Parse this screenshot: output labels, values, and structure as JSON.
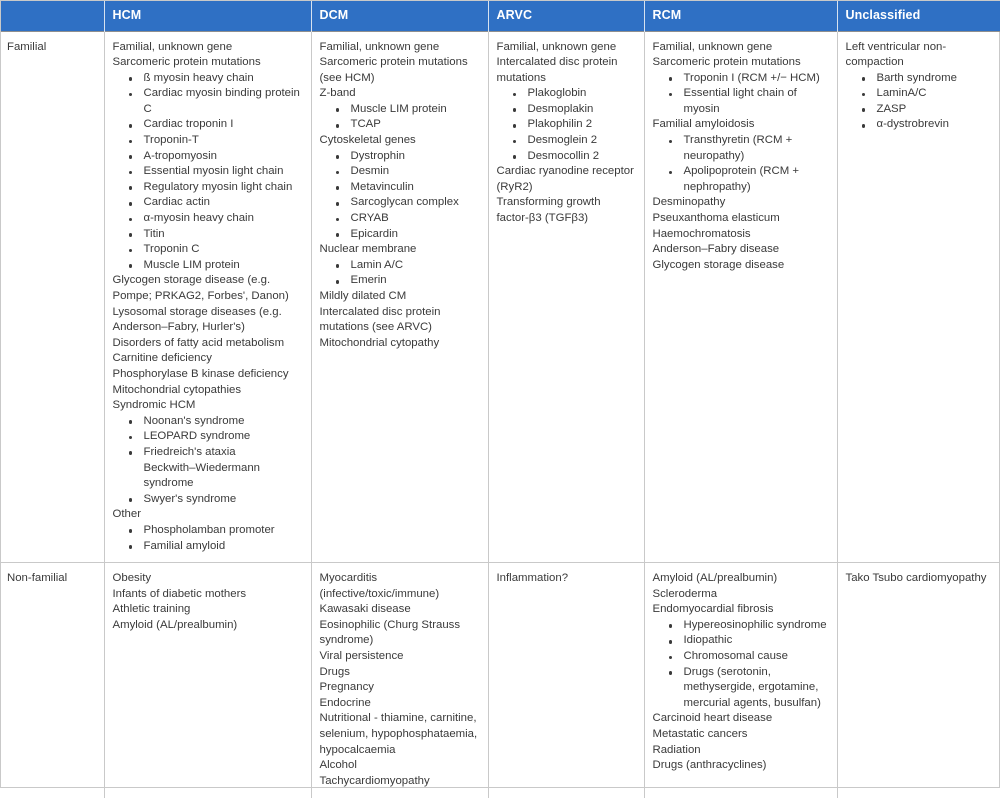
{
  "table": {
    "headers": [
      {
        "label": "",
        "name": "header-corner"
      },
      {
        "label": "HCM",
        "name": "header-hcm"
      },
      {
        "label": "DCM",
        "name": "header-dcm"
      },
      {
        "label": "ARVC",
        "name": "header-arvc"
      },
      {
        "label": "RCM",
        "name": "header-rcm"
      },
      {
        "label": "Unclassified",
        "name": "header-unclassified"
      }
    ],
    "header_bg": "#2f70c4",
    "header_text_color": "#ffffff",
    "body_text_color": "#3a3a3a",
    "border_color": "#c9c9c9",
    "rows": [
      {
        "label": "Familial",
        "cells": {
          "hcm": [
            {
              "text": "Familial, unknown gene",
              "style": "plain"
            },
            {
              "text": "Sarcomeric protein mutations",
              "style": "plain"
            },
            {
              "text": "ß myosin heavy chain",
              "style": "bulleted"
            },
            {
              "text": "Cardiac myosin binding protein C",
              "style": "bulleted"
            },
            {
              "text": "Cardiac troponin I",
              "style": "bulleted"
            },
            {
              "text": "Troponin-T",
              "style": "bulleted"
            },
            {
              "text": "A-tropomyosin",
              "style": "bulleted"
            },
            {
              "text": "Essential myosin light chain",
              "style": "bulleted"
            },
            {
              "text": "Regulatory myosin light chain",
              "style": "bulleted"
            },
            {
              "text": "Cardiac actin",
              "style": "bulleted"
            },
            {
              "text": "α-myosin heavy chain",
              "style": "bulleted"
            },
            {
              "text": "Titin",
              "style": "bulleted"
            },
            {
              "text": "Troponin C",
              "style": "bulleted"
            },
            {
              "text": "Muscle LIM protein",
              "style": "bulleted"
            },
            {
              "text": "Glycogen storage disease (e.g. Pompe; PRKAG2, Forbes', Danon)",
              "style": "plain"
            },
            {
              "text": "Lysosomal storage diseases (e.g. Anderson–Fabry, Hurler's)",
              "style": "plain"
            },
            {
              "text": "Disorders of fatty acid metabolism",
              "style": "plain"
            },
            {
              "text": "Carnitine deficiency",
              "style": "plain"
            },
            {
              "text": "Phosphorylase B kinase deficiency",
              "style": "plain"
            },
            {
              "text": "Mitochondrial cytopathies",
              "style": "plain"
            },
            {
              "text": "Syndromic HCM",
              "style": "plain"
            },
            {
              "text": "Noonan's syndrome",
              "style": "bulleted"
            },
            {
              "text": "LEOPARD syndrome",
              "style": "bulleted"
            },
            {
              "text": "Friedreich's ataxia",
              "style": "bulleted"
            },
            {
              "text": "Beckwith–Wiedermann syndrome",
              "style": "nobullet-indent"
            },
            {
              "text": "Swyer's syndrome",
              "style": "bulleted"
            },
            {
              "text": "Other",
              "style": "plain"
            },
            {
              "text": "Phospholamban promoter",
              "style": "bulleted"
            },
            {
              "text": "Familial amyloid",
              "style": "bulleted"
            }
          ],
          "dcm": [
            {
              "text": "Familial, unknown gene",
              "style": "plain"
            },
            {
              "text": "Sarcomeric protein mutations (see HCM)",
              "style": "plain"
            },
            {
              "text": "Z-band",
              "style": "plain"
            },
            {
              "text": "Muscle LIM protein",
              "style": "bulleted"
            },
            {
              "text": "TCAP",
              "style": "bulleted"
            },
            {
              "text": "Cytoskeletal genes",
              "style": "plain"
            },
            {
              "text": "Dystrophin",
              "style": "bulleted"
            },
            {
              "text": "Desmin",
              "style": "bulleted"
            },
            {
              "text": "Metavinculin",
              "style": "bulleted"
            },
            {
              "text": "Sarcoglycan complex",
              "style": "bulleted"
            },
            {
              "text": "CRYAB",
              "style": "bulleted"
            },
            {
              "text": "Epicardin",
              "style": "bulleted"
            },
            {
              "text": "Nuclear membrane",
              "style": "plain"
            },
            {
              "text": "Lamin A/C",
              "style": "bulleted"
            },
            {
              "text": "Emerin",
              "style": "bulleted"
            },
            {
              "text": "Mildly dilated CM",
              "style": "plain"
            },
            {
              "text": "Intercalated disc protein mutations (see ARVC)",
              "style": "plain"
            },
            {
              "text": "Mitochondrial cytopathy",
              "style": "plain"
            }
          ],
          "arvc": [
            {
              "text": "Familial, unknown gene",
              "style": "plain"
            },
            {
              "text": "Intercalated disc protein mutations",
              "style": "plain"
            },
            {
              "text": "Plakoglobin",
              "style": "bulleted"
            },
            {
              "text": "Desmoplakin",
              "style": "bulleted"
            },
            {
              "text": "Plakophilin 2",
              "style": "bulleted"
            },
            {
              "text": "Desmoglein 2",
              "style": "bulleted"
            },
            {
              "text": "Desmocollin 2",
              "style": "bulleted"
            },
            {
              "text": "Cardiac ryanodine receptor (RyR2)",
              "style": "plain"
            },
            {
              "text": "Transforming growth factor-β3 (TGFβ3)",
              "style": "plain"
            }
          ],
          "rcm": [
            {
              "text": "Familial, unknown gene",
              "style": "plain"
            },
            {
              "text": "Sarcomeric protein mutations",
              "style": "plain"
            },
            {
              "text": "Troponin I (RCM +/− HCM)",
              "style": "bulleted"
            },
            {
              "text": "Essential light chain of myosin",
              "style": "bulleted"
            },
            {
              "text": "Familial amyloidosis",
              "style": "plain"
            },
            {
              "text": "Transthyretin (RCM + neuropathy)",
              "style": "bulleted"
            },
            {
              "text": "Apolipoprotein (RCM + nephropathy)",
              "style": "bulleted"
            },
            {
              "text": "Desminopathy",
              "style": "plain"
            },
            {
              "text": "Pseuxanthoma elasticum",
              "style": "plain"
            },
            {
              "text": "Haemochromatosis",
              "style": "plain"
            },
            {
              "text": "Anderson–Fabry disease",
              "style": "plain"
            },
            {
              "text": "Glycogen storage disease",
              "style": "plain"
            }
          ],
          "unclassified": [
            {
              "text": "Left ventricular non-compaction",
              "style": "plain"
            },
            {
              "text": "Barth syndrome",
              "style": "bulleted"
            },
            {
              "text": "LaminA/C",
              "style": "bulleted"
            },
            {
              "text": "ZASP",
              "style": "bulleted"
            },
            {
              "text": "α-dystrobrevin",
              "style": "bulleted"
            }
          ]
        }
      },
      {
        "label": "Non-familial",
        "cells": {
          "hcm": [
            {
              "text": "Obesity",
              "style": "plain"
            },
            {
              "text": "Infants of diabetic mothers",
              "style": "plain"
            },
            {
              "text": "Athletic training",
              "style": "plain"
            },
            {
              "text": "Amyloid (AL/prealbumin)",
              "style": "plain"
            }
          ],
          "dcm": [
            {
              "text": "Myocarditis (infective/toxic/immune)",
              "style": "plain"
            },
            {
              "text": "Kawasaki disease",
              "style": "plain"
            },
            {
              "text": "Eosinophilic (Churg Strauss syndrome)",
              "style": "plain"
            },
            {
              "text": "Viral persistence",
              "style": "plain"
            },
            {
              "text": "Drugs",
              "style": "plain"
            },
            {
              "text": "Pregnancy",
              "style": "plain"
            },
            {
              "text": "Endocrine",
              "style": "plain"
            },
            {
              "text": "Nutritional - thiamine, carnitine, selenium, hypophosphataemia, hypocalcaemia",
              "style": "plain"
            },
            {
              "text": "Alcohol",
              "style": "plain"
            },
            {
              "text": "Tachycardiomyopathy",
              "style": "plain"
            }
          ],
          "arvc": [
            {
              "text": "Inflammation?",
              "style": "plain"
            }
          ],
          "rcm": [
            {
              "text": "Amyloid (AL/prealbumin)",
              "style": "plain"
            },
            {
              "text": "Scleroderma",
              "style": "plain"
            },
            {
              "text": "Endomyocardial fibrosis",
              "style": "plain"
            },
            {
              "text": "Hypereosinophilic syndrome",
              "style": "bulleted"
            },
            {
              "text": "Idiopathic",
              "style": "bulleted"
            },
            {
              "text": "Chromosomal cause",
              "style": "bulleted"
            },
            {
              "text": "Drugs (serotonin, methysergide, ergotamine, mercurial agents, busulfan)",
              "style": "bulleted"
            },
            {
              "text": "Carcinoid heart disease",
              "style": "plain"
            },
            {
              "text": "Metastatic cancers",
              "style": "plain"
            },
            {
              "text": "Radiation",
              "style": "plain"
            },
            {
              "text": "Drugs (anthracyclines)",
              "style": "plain"
            }
          ],
          "unclassified": [
            {
              "text": "Tako Tsubo cardiomyopathy",
              "style": "plain"
            }
          ]
        }
      }
    ]
  }
}
